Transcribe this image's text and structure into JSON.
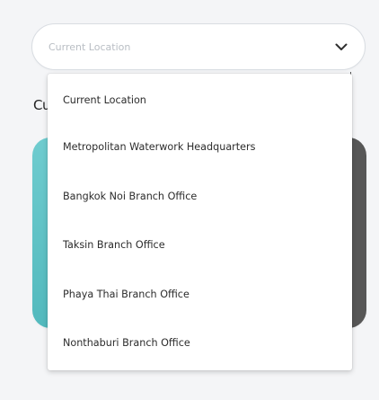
{
  "location_select": {
    "placeholder": "Current Location",
    "chevron_icon": "chevron-down-icon"
  },
  "background": {
    "label": "Cu"
  },
  "dropdown": {
    "options": [
      {
        "label": "Current Location"
      },
      {
        "label": "Metropolitan Waterwork Headquarters"
      },
      {
        "label": "Bangkok Noi Branch Office"
      },
      {
        "label": "Taksin Branch Office"
      },
      {
        "label": "Phaya Thai Branch Office"
      },
      {
        "label": "Nonthaburi Branch Office"
      }
    ]
  },
  "colors": {
    "page_background": "#f4f5f7",
    "accent_teal": "#5fc3c7",
    "placeholder_text": "#b9bec4"
  }
}
